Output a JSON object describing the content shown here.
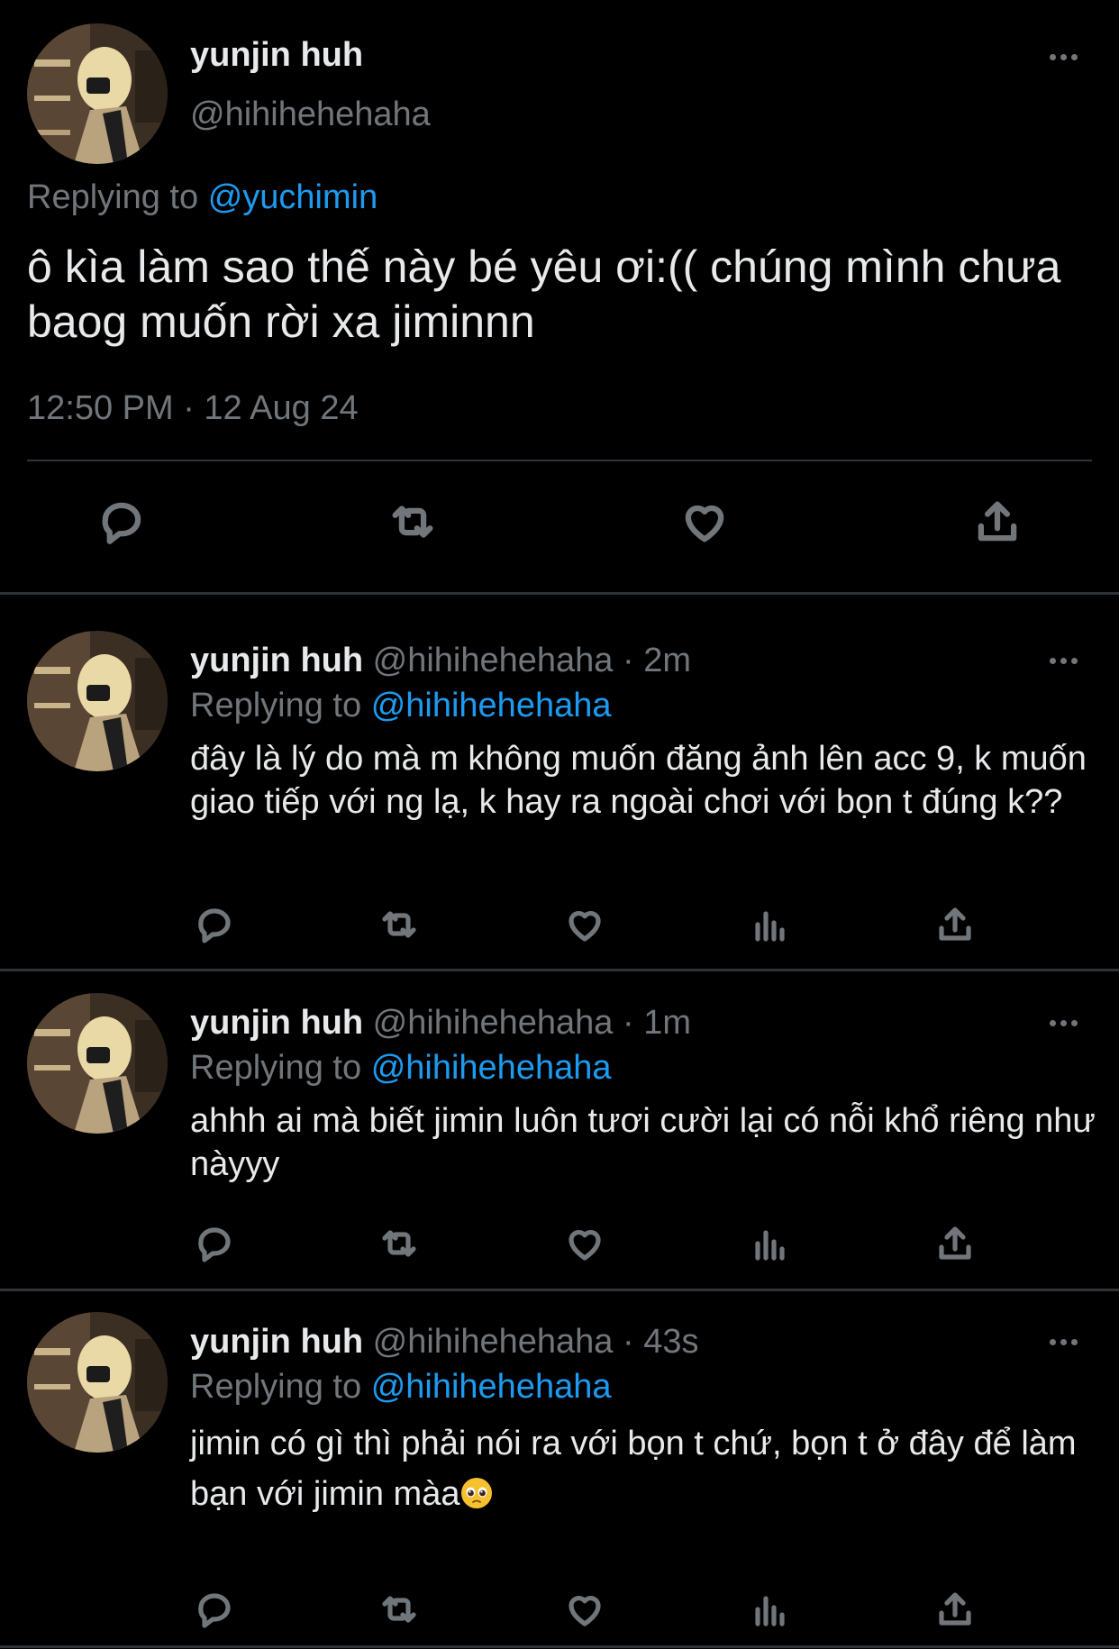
{
  "main_tweet": {
    "author_name": "yunjin huh",
    "author_handle": "@hihihehehaha",
    "replying_label": "Replying to",
    "replying_to": "@yuchimin",
    "text": "ô kìa làm sao thế này bé yêu ơi:(( chúng mình chưa baog muốn rời xa jiminnn",
    "timestamp": "12:50 PM · 12 Aug 24",
    "actions": [
      "reply-icon",
      "retweet-icon",
      "like-icon",
      "share-icon"
    ]
  },
  "replies": [
    {
      "author_name": "yunjin huh",
      "author_handle": "@hihihehehaha",
      "time": "· 2m",
      "replying_label": "Replying to",
      "replying_to": "@hihihehehaha",
      "text": "đây là lý do mà m không muốn đăng ảnh lên acc 9, k muốn giao tiếp với ng lạ, k hay ra ngoài chơi với bọn t đúng k??"
    },
    {
      "author_name": "yunjin huh",
      "author_handle": "@hihihehehaha",
      "time": "· 1m",
      "replying_label": "Replying to",
      "replying_to": "@hihihehehaha",
      "text": "ahhh ai mà biết jimin luôn tươi cười lại có nỗi khổ riêng như nàyyy"
    },
    {
      "author_name": "yunjin huh",
      "author_handle": "@hihihehehaha",
      "time": "· 43s",
      "replying_label": "Replying to",
      "replying_to": "@hihihehehaha",
      "text": "jimin có gì thì phải nói ra với bọn t chứ, bọn t ở đây để làm bạn với jimin màa",
      "trailing_emoji": "pleading-face-emoji"
    }
  ],
  "reply_actions": [
    "reply-icon",
    "retweet-icon",
    "like-icon",
    "views-icon",
    "share-icon"
  ],
  "colors": {
    "background": "#000000",
    "text": "#e7e9ea",
    "muted": "#71767b",
    "link": "#1d9bf0",
    "divider": "#2f3336"
  }
}
